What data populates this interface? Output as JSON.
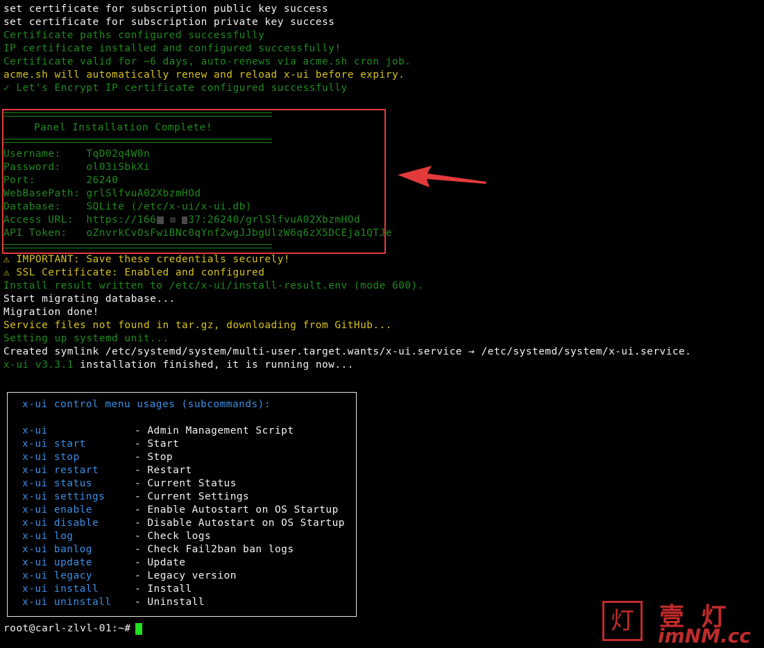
{
  "terminal": {
    "pre_lines": [
      "set certificate for subscription public key success",
      "set certificate for subscription private key success",
      "Certificate paths configured successfully",
      "IP certificate installed and configured successfully!",
      "Certificate valid for ~6 days, auto-renews via acme.sh cron job.",
      "acme.sh will automatically renew and reload x-ui before expiry.",
      "✓ Let's Encrypt IP certificate configured successfully"
    ],
    "panel": {
      "title": "Panel Installation Complete!",
      "username_label": "Username:    ",
      "username_value": "TqD02q4W0n",
      "password_label": "Password:    ",
      "password_value": "ol03iSbkXi",
      "port_label": "Port:        ",
      "port_value": "26240",
      "webbasepath_label": "WebBasePath: ",
      "webbasepath_value": "grlSlfvuA02XbzmHOd",
      "database_label": "Database:    ",
      "database_value": "SQLite (/etc/x-ui/x-ui.db)",
      "access_label": "Access URL:  ",
      "access_prefix": "https://166",
      "access_suffix": "37:26240/grlSlfvuA02XbzmHOd",
      "token_label": "API Token:   ",
      "token_value": "oZnvrkCvOsFwiBNc0qYnf2wgJJbgUlzW6q6zX5DCEja1QTJe"
    },
    "post_lines": [
      "⚠ IMPORTANT: Save these credentials securely!",
      "⚠ SSL Certificate: Enabled and configured",
      "Install result written to /etc/x-ui/install-result.env (mode 600).",
      "Start migrating database...",
      "Migration done!",
      "Service files not found in tar.gz, downloading from GitHub...",
      "Setting up systemd unit...",
      "Created symlink /etc/systemd/system/multi-user.target.wants/x-ui.service → /etc/systemd/system/x-ui.service."
    ],
    "version_text": "x-ui v3.3.1",
    "finished_text": " installation finished, it is running now...",
    "menu": {
      "title": "x-ui control menu usages (subcommands):",
      "items": [
        {
          "cmd": "x-ui",
          "desc": "- Admin Management Script"
        },
        {
          "cmd": "x-ui start",
          "desc": "- Start"
        },
        {
          "cmd": "x-ui stop",
          "desc": "- Stop"
        },
        {
          "cmd": "x-ui restart",
          "desc": "- Restart"
        },
        {
          "cmd": "x-ui status",
          "desc": "- Current Status"
        },
        {
          "cmd": "x-ui settings",
          "desc": "- Current Settings"
        },
        {
          "cmd": "x-ui enable",
          "desc": "- Enable Autostart on OS Startup"
        },
        {
          "cmd": "x-ui disable",
          "desc": "- Disable Autostart on OS Startup"
        },
        {
          "cmd": "x-ui log",
          "desc": "- Check logs"
        },
        {
          "cmd": "x-ui banlog",
          "desc": "- Check Fail2ban ban logs"
        },
        {
          "cmd": "x-ui update",
          "desc": "- Update"
        },
        {
          "cmd": "x-ui legacy",
          "desc": "- Legacy version"
        },
        {
          "cmd": "x-ui install",
          "desc": "- Install"
        },
        {
          "cmd": "x-ui uninstall",
          "desc": "- Uninstall"
        }
      ]
    },
    "prompt": "root@carl-zlvl-01:~#"
  },
  "watermark": {
    "logo_char": "灯",
    "cn_text": "壹 灯",
    "domain_text": "imNM.cc"
  },
  "colors": {
    "background": "#000000",
    "text_white": "#f2f2f2",
    "text_green": "#1f8a1f",
    "text_yellow": "#d6c21c",
    "text_blue": "#3a8ee6",
    "annotation_red": "#e33b3b",
    "cursor_green": "#22e022"
  }
}
